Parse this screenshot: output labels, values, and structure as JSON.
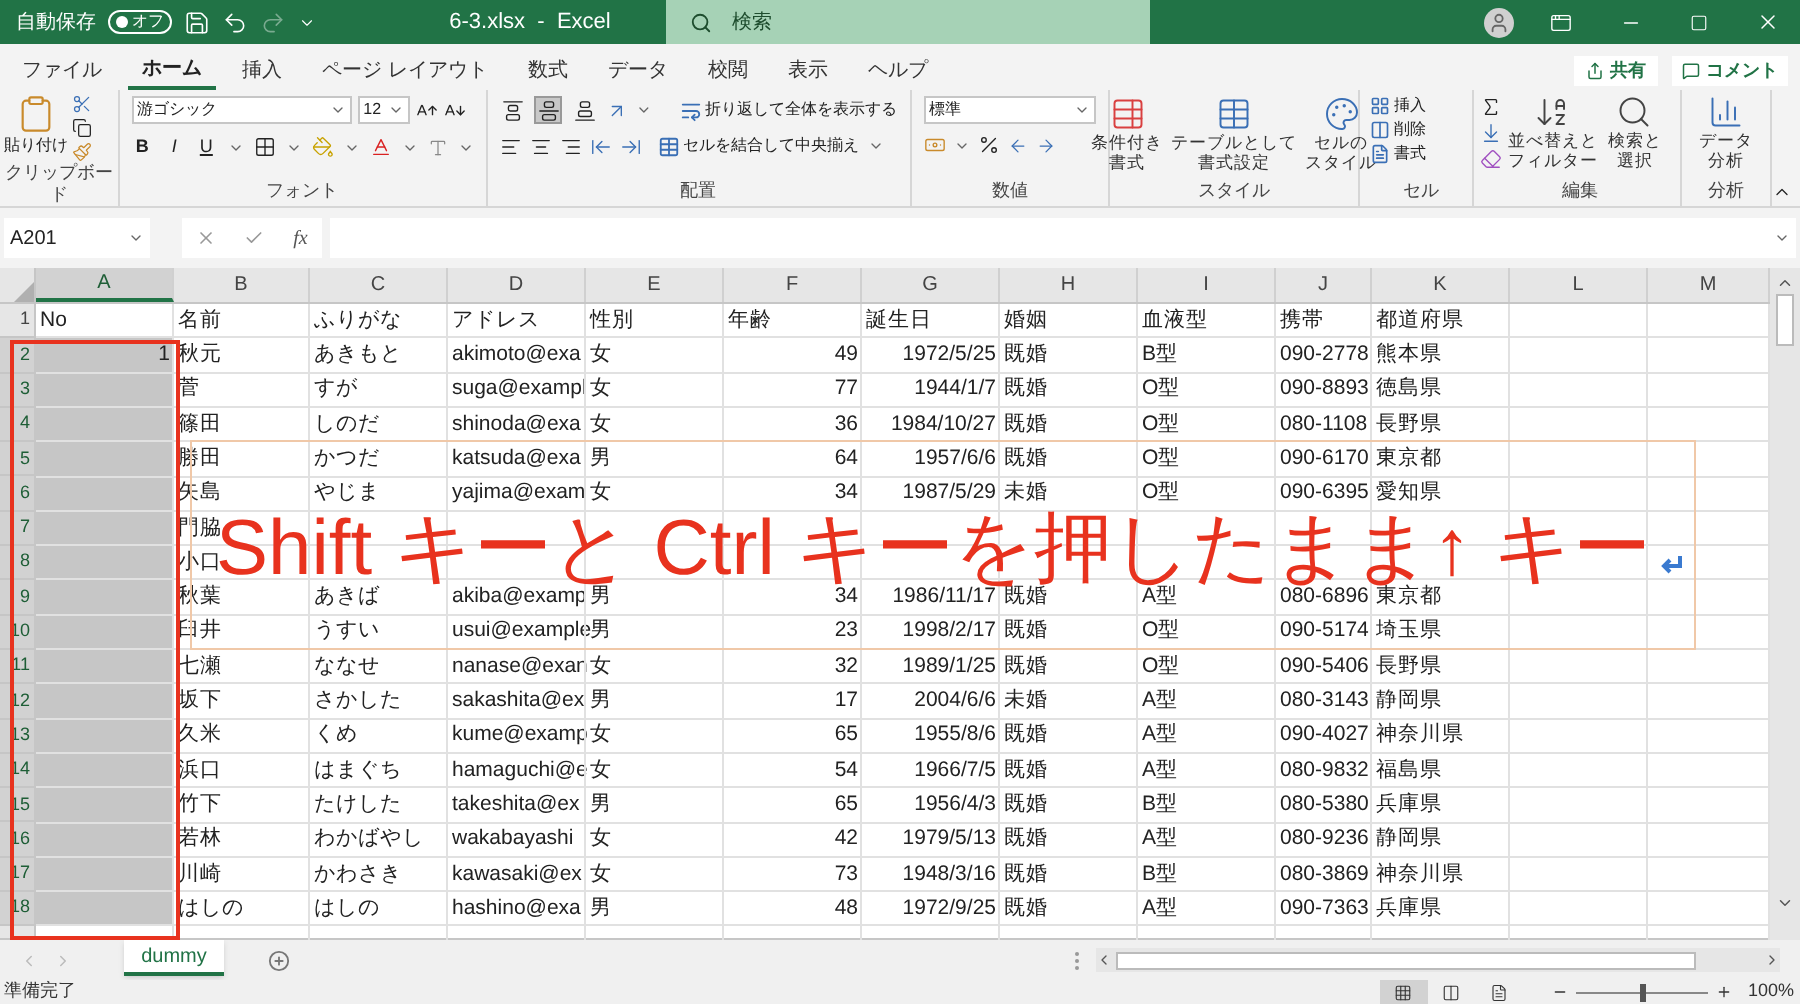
{
  "title_bar": {
    "autosave": {
      "label": "自動保存",
      "on": false,
      "toggle_text": "オフ"
    },
    "title": "6-3.xlsx  -  Excel",
    "search": {
      "label": "検索"
    }
  },
  "menu_tabs": [
    {
      "label": "ファイル",
      "selected": false
    },
    {
      "label": "ホーム",
      "selected": true
    },
    {
      "label": "挿入",
      "selected": false
    },
    {
      "label": "ページ レイアウト",
      "selected": false
    },
    {
      "label": "数式",
      "selected": false
    },
    {
      "label": "データ",
      "selected": false
    },
    {
      "label": "校閲",
      "selected": false
    },
    {
      "label": "表示",
      "selected": false
    },
    {
      "label": "ヘルプ",
      "selected": false
    }
  ],
  "share_button": "共有",
  "comment_button": "コメント",
  "ribbon": {
    "clipboard": {
      "paste": "貼り付け",
      "label": "クリップボード"
    },
    "font": {
      "font_name": "游ゴシック",
      "font_size": "12",
      "styles": [
        "B",
        "I",
        "U"
      ],
      "label": "フォント"
    },
    "alignment": {
      "vertical_align": [
        {
          "selected": false
        },
        {
          "selected": true
        },
        {
          "selected": false
        }
      ],
      "wrap": "折り返して全体を表示する",
      "merge": "セルを結合して中央揃え",
      "label": "配置"
    },
    "number": {
      "format": "標準",
      "label": "数値"
    },
    "styles": {
      "buttons": [
        [
          "条件付き",
          "書式"
        ],
        [
          "テーブルとして",
          "書式設定"
        ],
        [
          "セルの",
          "スタイル"
        ]
      ],
      "label": "スタイル"
    },
    "cells": {
      "buttons": [
        "挿入",
        "削除",
        "書式"
      ],
      "label": "セル"
    },
    "editing": {
      "buttons": [
        [
          "並べ替えと",
          "フィルター"
        ],
        [
          "検索と",
          "選択"
        ]
      ],
      "label": "編集"
    },
    "analysis": {
      "buttons": [
        [
          "データ",
          "分析"
        ]
      ],
      "label": "分析"
    }
  },
  "formula_bar": {
    "name_box": "A201",
    "fx": "fx"
  },
  "sheet": {
    "columns": [
      {
        "label": "A",
        "kind": "number",
        "selected": true
      },
      {
        "label": "B",
        "kind": "text",
        "selected": false
      },
      {
        "label": "C",
        "kind": "text",
        "selected": false
      },
      {
        "label": "D",
        "kind": "text",
        "selected": false
      },
      {
        "label": "E",
        "kind": "text",
        "selected": false
      },
      {
        "label": "F",
        "kind": "number",
        "selected": false
      },
      {
        "label": "G",
        "kind": "number",
        "selected": false
      },
      {
        "label": "H",
        "kind": "text",
        "selected": false
      },
      {
        "label": "I",
        "kind": "text",
        "selected": false
      },
      {
        "label": "J",
        "kind": "text",
        "selected": false
      },
      {
        "label": "K",
        "kind": "text",
        "selected": false
      },
      {
        "label": "L",
        "kind": "text",
        "selected": false
      },
      {
        "label": "M",
        "kind": "text",
        "selected": false
      }
    ],
    "rows": [
      {
        "number": "1",
        "selected": false,
        "cells": [
          "No",
          "名前",
          "ふりがな",
          "アドレス",
          "性別",
          "年齢",
          "誕生日",
          "婚姻",
          "血液型",
          "携帯",
          "都道府県"
        ]
      },
      {
        "number": "2",
        "selected": true,
        "cells": [
          "1",
          "秋元",
          "あきもと",
          "akimoto@exa",
          "女",
          "49",
          "1972/5/25",
          "既婚",
          "B型",
          "090-2778",
          "熊本県"
        ]
      },
      {
        "number": "3",
        "selected": true,
        "cells": [
          "",
          "菅",
          "すが",
          "suga@exampl",
          "女",
          "77",
          "1944/1/7",
          "既婚",
          "O型",
          "090-8893",
          "徳島県"
        ]
      },
      {
        "number": "4",
        "selected": true,
        "cells": [
          "",
          "篠田",
          "しのだ",
          "shinoda@exa",
          "女",
          "36",
          "1984/10/27",
          "既婚",
          "O型",
          "080-1108",
          "長野県"
        ]
      },
      {
        "number": "5",
        "selected": true,
        "cells": [
          "",
          "勝田",
          "かつだ",
          "katsuda@exa",
          "男",
          "64",
          "1957/6/6",
          "既婚",
          "O型",
          "090-6170",
          "東京都"
        ]
      },
      {
        "number": "6",
        "selected": true,
        "cells": [
          "",
          "矢島",
          "やじま",
          "yajima@exam",
          "女",
          "34",
          "1987/5/29",
          "未婚",
          "O型",
          "090-6395",
          "愛知県"
        ]
      },
      {
        "number": "7",
        "selected": true,
        "cells": [
          "",
          "門脇",
          "",
          "",
          "",
          "",
          "",
          "",
          "",
          "",
          ""
        ]
      },
      {
        "number": "8",
        "selected": true,
        "cells": [
          "",
          "小口",
          "",
          "",
          "",
          "",
          "",
          "",
          "",
          "",
          ""
        ]
      },
      {
        "number": "9",
        "selected": true,
        "cells": [
          "",
          "秋葉",
          "あきば",
          "akiba@examp",
          "男",
          "34",
          "1986/11/17",
          "既婚",
          "A型",
          "080-6896",
          "東京都"
        ]
      },
      {
        "number": "10",
        "selected": true,
        "cells": [
          "",
          "臼井",
          "うすい",
          "usui@example",
          "男",
          "23",
          "1998/2/17",
          "既婚",
          "O型",
          "090-5174",
          "埼玉県"
        ]
      },
      {
        "number": "11",
        "selected": true,
        "cells": [
          "",
          "七瀬",
          "ななせ",
          "nanase@exan",
          "女",
          "32",
          "1989/1/25",
          "既婚",
          "O型",
          "090-5406",
          "長野県"
        ]
      },
      {
        "number": "12",
        "selected": true,
        "cells": [
          "",
          "坂下",
          "さかした",
          "sakashita@ex",
          "男",
          "17",
          "2004/6/6",
          "未婚",
          "A型",
          "080-3143",
          "静岡県"
        ]
      },
      {
        "number": "13",
        "selected": true,
        "cells": [
          "",
          "久米",
          "くめ",
          "kume@examp",
          "女",
          "65",
          "1955/8/6",
          "既婚",
          "A型",
          "090-4027",
          "神奈川県"
        ]
      },
      {
        "number": "14",
        "selected": true,
        "cells": [
          "",
          "浜口",
          "はまぐち",
          "hamaguchi@e",
          "女",
          "54",
          "1966/7/5",
          "既婚",
          "A型",
          "080-9832",
          "福島県"
        ]
      },
      {
        "number": "15",
        "selected": true,
        "cells": [
          "",
          "竹下",
          "たけした",
          "takeshita@ex",
          "男",
          "65",
          "1956/4/3",
          "既婚",
          "B型",
          "080-5380",
          "兵庫県"
        ]
      },
      {
        "number": "16",
        "selected": true,
        "cells": [
          "",
          "若林",
          "わかばやし",
          "wakabayashi",
          "女",
          "42",
          "1979/5/13",
          "既婚",
          "A型",
          "080-9236",
          "静岡県"
        ]
      },
      {
        "number": "17",
        "selected": true,
        "cells": [
          "",
          "川崎",
          "かわさき",
          "kawasaki@ex",
          "女",
          "73",
          "1948/3/16",
          "既婚",
          "B型",
          "080-3869",
          "神奈川県"
        ]
      },
      {
        "number": "18",
        "selected": true,
        "cells": [
          "",
          "はしの",
          "はしの",
          "hashino@exa",
          "男",
          "48",
          "1972/9/25",
          "既婚",
          "A型",
          "090-7363",
          "兵庫県"
        ]
      }
    ]
  },
  "annotation": {
    "text": "Shift キーと Ctrl キーを押したまま↑ キー"
  },
  "sheet_tabs": [
    {
      "label": "dummy",
      "selected": true
    }
  ],
  "status_bar": {
    "status": "準備完了",
    "views": [
      {
        "selected": true
      },
      {
        "selected": false
      },
      {
        "selected": false
      }
    ],
    "zoom": {
      "level": 0.5,
      "reading": "100%"
    }
  }
}
